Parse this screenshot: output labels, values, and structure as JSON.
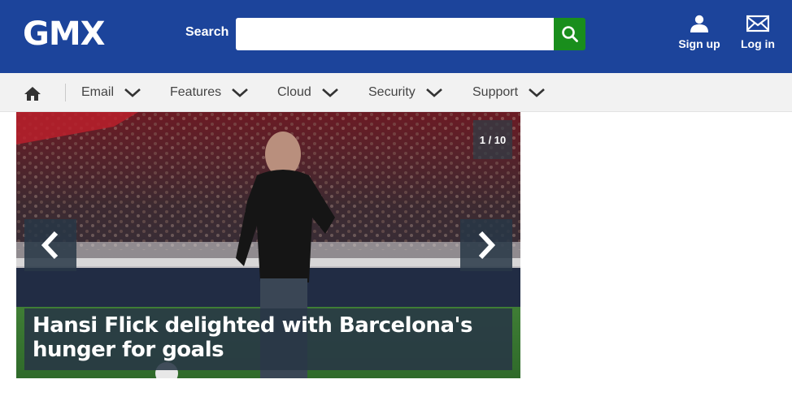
{
  "header": {
    "logo": "GMX",
    "search": {
      "label": "Search",
      "value": "",
      "placeholder": ""
    },
    "actions": {
      "signup": "Sign up",
      "login": "Log in"
    },
    "colors": {
      "brand": "#1c449b",
      "search_button": "#198e1c"
    }
  },
  "nav": {
    "home_icon": "home-icon",
    "items": [
      {
        "label": "Email"
      },
      {
        "label": "Features"
      },
      {
        "label": "Cloud"
      },
      {
        "label": "Security"
      },
      {
        "label": "Support"
      }
    ]
  },
  "slideshow": {
    "counter": "1 / 10",
    "headline": "Hansi Flick delighted with Barcelona's hunger for goals",
    "prev_icon": "chevron-left-icon",
    "next_icon": "chevron-right-icon"
  }
}
